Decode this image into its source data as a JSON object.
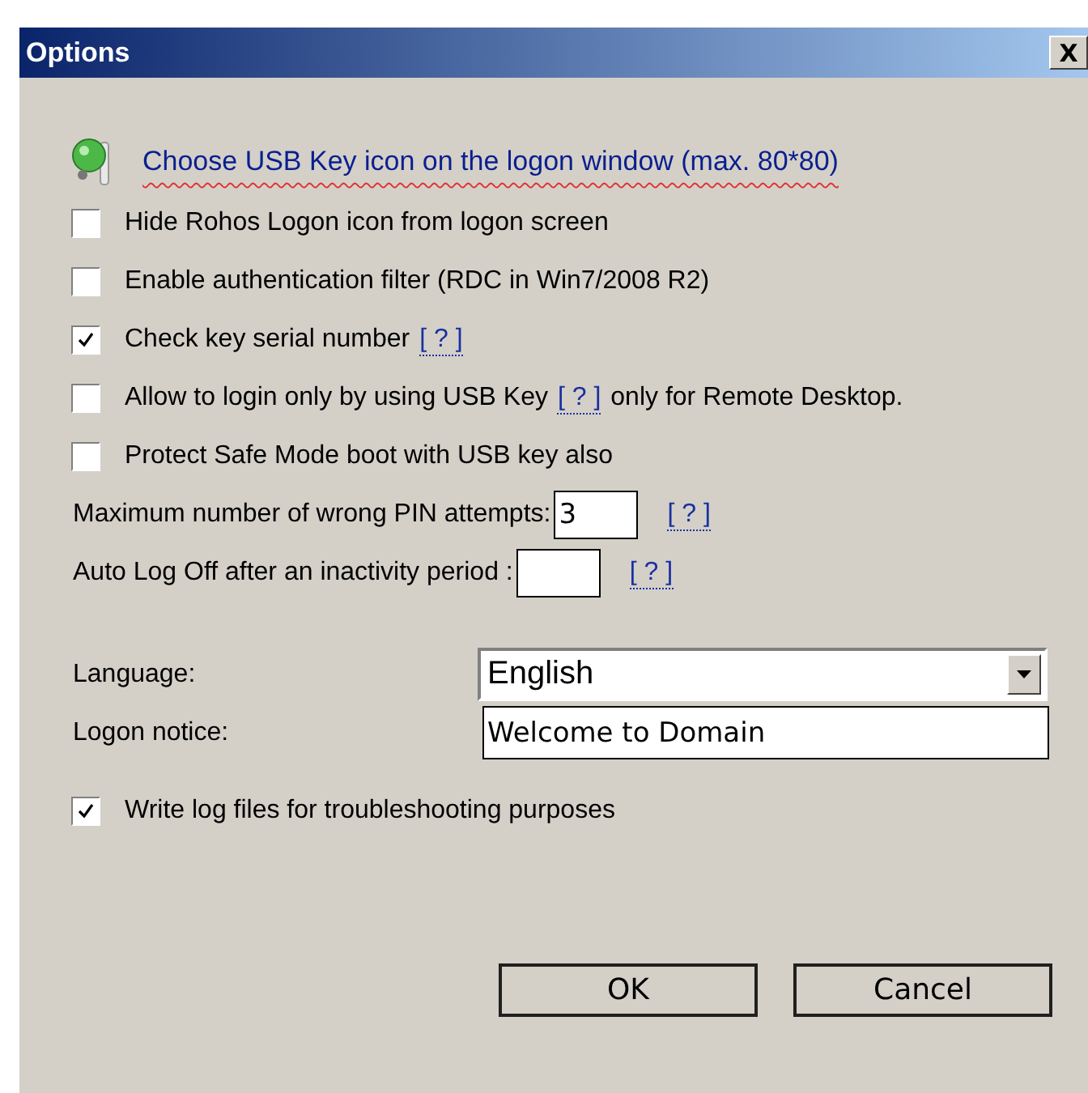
{
  "window": {
    "title": "Options",
    "close": "X"
  },
  "usb_icon_link": "Choose USB Key icon on the logon window (max. 80*80)",
  "options": [
    {
      "label": "Hide Rohos Logon icon from logon screen",
      "checked": false
    },
    {
      "label": "Enable authentication filter (RDC in Win7/2008 R2)",
      "checked": false
    },
    {
      "label": "Check key serial number",
      "help": "[ ? ]",
      "checked": true
    },
    {
      "label": "Allow to login only by using USB Key",
      "help": "[ ? ]",
      "after": "only for Remote Desktop.",
      "checked": false
    },
    {
      "label": "Protect Safe Mode boot with USB key also",
      "checked": false
    }
  ],
  "pin_attempts": {
    "label": "Maximum number of wrong PIN attempts:",
    "value": "3",
    "help": "[ ? ]"
  },
  "auto_logoff": {
    "label": "Auto Log Off after an inactivity period :",
    "help": "[ ? ]"
  },
  "language": {
    "label": "Language:",
    "value": "English"
  },
  "logon_notice": {
    "label": "Logon notice:",
    "value": "Welcome to Domain"
  },
  "write_log": {
    "label": "Write log files for troubleshooting purposes",
    "checked": true
  },
  "buttons": [
    "OK",
    "Cancel"
  ]
}
